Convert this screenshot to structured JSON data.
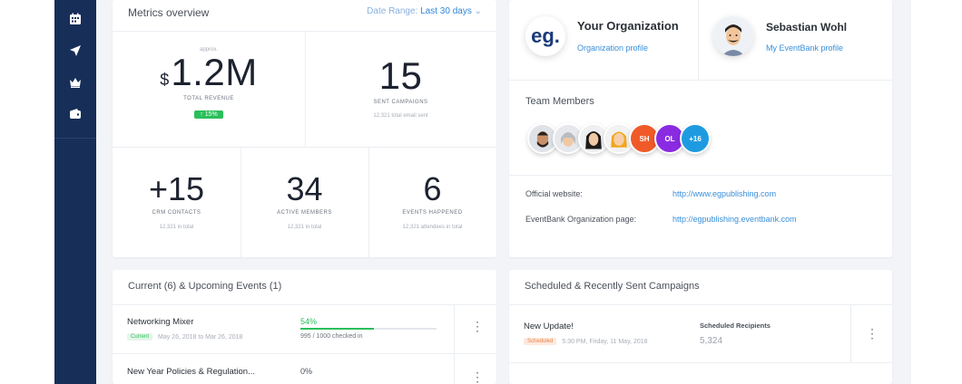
{
  "metrics": {
    "title": "Metrics overview",
    "date_range_label": "Date Range:",
    "date_range_value": "Last 30 days",
    "revenue": {
      "currency": "$",
      "value": "1.2M",
      "label": "Total revenue",
      "top_note": "approx.",
      "change": "↑ 15%"
    },
    "sent": {
      "value": "15",
      "label": "Sent campaigns",
      "note": "12,321 total email sent"
    },
    "crm": {
      "value": "+15",
      "label": "CRM contacts",
      "note": "12,321 in total"
    },
    "members": {
      "value": "34",
      "label": "Active members",
      "note": "12,321 in total"
    },
    "events": {
      "value": "6",
      "label": "Events happened",
      "note": "12,321 attendees in total"
    }
  },
  "org": {
    "logo_text": "eg.",
    "name": "Your Organization",
    "profile_link": "Organization profile",
    "user_name": "Sebastian Wohl",
    "user_link": "My EventBank profile",
    "team_title": "Team Members",
    "team_initials": [
      "SH",
      "OL",
      "+16"
    ],
    "website_label": "Official website:",
    "website_url": "http://www.egpublishing.com",
    "eventbank_label": "EventBank Organization page:",
    "eventbank_url": "http://egpublishing.eventbank.com"
  },
  "events": {
    "title": "Current (6) & Upcoming Events (1)",
    "rows": [
      {
        "name": "Networking Mixer",
        "status": "Current",
        "dates": "May 26, 2018 to Mar 26, 2018",
        "percent": "54%",
        "checked": "995 / 1000 checked in",
        "progress": 0.54
      },
      {
        "name": "New Year Policies & Regulation...",
        "percent": "0%",
        "progress": 0
      }
    ]
  },
  "campaigns": {
    "title": "Scheduled & Recently Sent Campaigns",
    "rows": [
      {
        "name": "New Update!",
        "status": "Scheduled",
        "time": "5:30 PM, Friday, 11 May, 2018",
        "recipients_label": "Scheduled Recipients",
        "recipients": "5,324"
      }
    ]
  },
  "colors": {
    "sidebar": "#172e59",
    "accent": "#2f86d8",
    "success": "#2bbf5b",
    "scheduled": "#f0a060"
  }
}
